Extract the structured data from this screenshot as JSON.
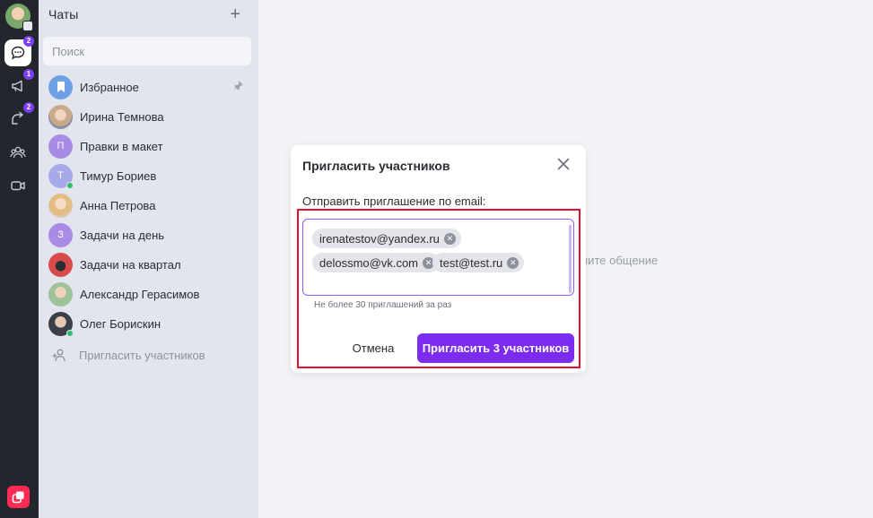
{
  "rail": {
    "badges": {
      "chats": "2",
      "channels": "1",
      "threads": "2"
    }
  },
  "sidebar": {
    "title": "Чаты",
    "search_placeholder": "Поиск",
    "chats": [
      {
        "name": "Избранное",
        "avatar": "bookmark",
        "color": "#6ea0e6",
        "pinned": true
      },
      {
        "name": "Ирина Темнова",
        "avatar": "photo",
        "color": "#b89c8a"
      },
      {
        "name": "Правки в макет",
        "avatar": "П",
        "color": "#a98be6"
      },
      {
        "name": "Тимур Бориев",
        "avatar": "Т",
        "color": "#a7a9e8",
        "online": true
      },
      {
        "name": "Анна Петрова",
        "avatar": "photo",
        "color": "#e0b98a"
      },
      {
        "name": "Задачи на день",
        "avatar": "З",
        "color": "#a98be6"
      },
      {
        "name": "Задачи на квартал",
        "avatar": "photo",
        "color": "#d94b4b"
      },
      {
        "name": "Александр Герасимов",
        "avatar": "photo",
        "color": "#7fb08a"
      },
      {
        "name": "Олег Борискин",
        "avatar": "photo",
        "color": "#5b6270",
        "online": true
      }
    ],
    "invite_label": "Пригласить участников"
  },
  "main": {
    "hint": "ните общение"
  },
  "modal": {
    "title": "Пригласить участников",
    "email_label": "Отправить приглашение по email:",
    "emails": [
      "irenatestov@yandex.ru",
      "delossmo@vk.com",
      "test@test.ru"
    ],
    "limit_hint": "Не более 30 приглашений за раз",
    "cancel_label": "Отмена",
    "submit_label": "Пригласить 3 участников"
  },
  "colors": {
    "accent": "#7b2cf0",
    "highlight": "#e0112b"
  }
}
